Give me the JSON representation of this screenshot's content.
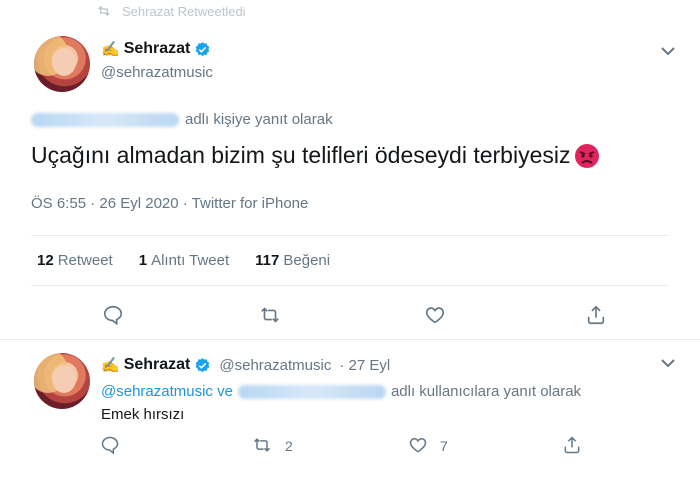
{
  "retweet_banner": {
    "text": "Sehrazat Retweetledi"
  },
  "main_tweet": {
    "author_name": "Sehrazat",
    "author_emoji": "✍️",
    "author_handle": "@sehrazatmusic",
    "reply_suffix": "adlı kişiye yanıt olarak",
    "text": "Uçağını almadan bizim şu telifleri ödeseydi terbiyesiz",
    "meta": "ÖS 6:55 · 26 Eyl 2020 · Twitter for iPhone",
    "stats": [
      {
        "count": "12",
        "label": "Retweet"
      },
      {
        "count": "1",
        "label": "Alıntı Tweet"
      },
      {
        "count": "117",
        "label": "Beğeni"
      }
    ]
  },
  "reply_tweet": {
    "author_name": "Sehrazat",
    "author_emoji": "✍️",
    "author_handle": "@sehrazatmusic",
    "date": "· 27 Eyl",
    "reply_prefix": "@sehrazatmusic ve",
    "reply_suffix": "adlı kullanıcılara yanıt olarak",
    "text": "Emek hırsızı",
    "retweet_count": "2",
    "like_count": "7"
  },
  "colors": {
    "link": "#1b95e0",
    "muted": "#657786",
    "verified": "#1da1f2",
    "angry": "#e0245e"
  },
  "icons": [
    "retweet-icon",
    "verified-icon",
    "chevron-down-icon",
    "angry-face-icon",
    "reply-icon",
    "like-icon",
    "share-icon"
  ]
}
